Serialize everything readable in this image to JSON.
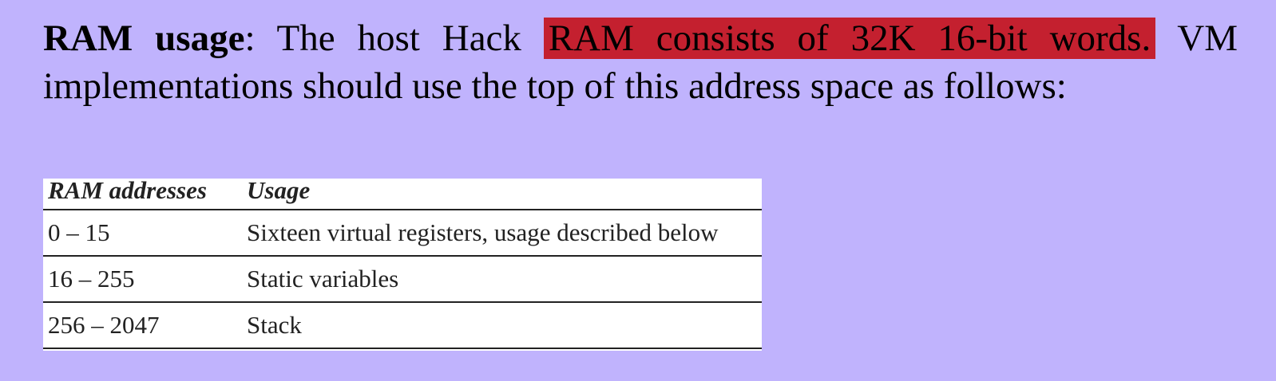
{
  "paragraph": {
    "bold_term": "RAM usage",
    "colon": ":",
    "text_before_highlight": " The host Hack ",
    "highlight": "RAM consists of 32K 16-bit words.",
    "text_after_highlight_line1": " VM",
    "line2": "implementations should use the top of this address space as follows:"
  },
  "colors": {
    "background": "#c0b3fd",
    "highlight": "#c4202f"
  },
  "table": {
    "headers": [
      "RAM addresses",
      "Usage"
    ],
    "rows": [
      [
        "0 – 15",
        "Sixteen virtual registers, usage described below"
      ],
      [
        "16 – 255",
        "Static variables"
      ],
      [
        "256 – 2047",
        "Stack"
      ]
    ]
  }
}
